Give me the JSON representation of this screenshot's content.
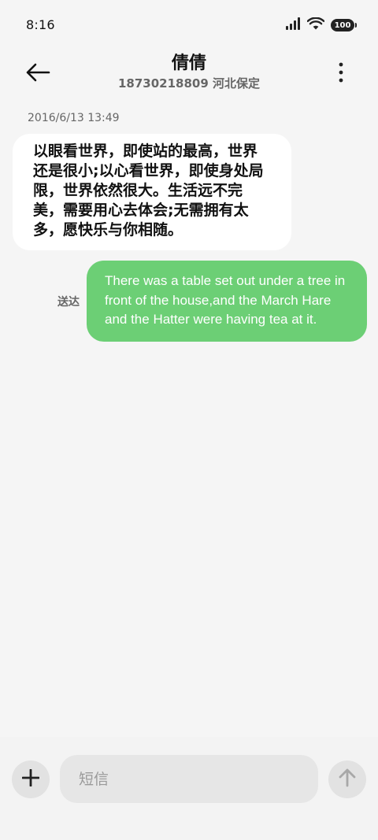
{
  "status_bar": {
    "time": "8:16",
    "battery": "100",
    "icons": [
      "signal-icon",
      "wifi-icon",
      "battery-icon"
    ]
  },
  "header": {
    "name": "倩倩",
    "subtitle": "18730218809 河北保定",
    "back_icon": "back-arrow-icon",
    "more_icon": "more-vertical-icon"
  },
  "conversation": {
    "timestamp": "2016/6/13 13:49",
    "incoming": {
      "text": "以眼看世界，即使站的最高，世界还是很小;以心看世界，即使身处局限，世界依然很大。生活远不完美，需要用心去体会;无需拥有太多，愿快乐与你相随。"
    },
    "outgoing": {
      "status": "送达",
      "text": "There was a table set out under a tree in front of the house,and the March Hare and the Hatter were having tea at it."
    }
  },
  "composer": {
    "placeholder": "短信",
    "value": "",
    "plus_icon": "plus-icon",
    "send_icon": "send-arrow-icon"
  },
  "colors": {
    "background": "#f5f5f5",
    "incoming_bubble": "#ffffff",
    "outgoing_bubble": "#6ccf75",
    "input_bar": "#f3f3f3"
  }
}
